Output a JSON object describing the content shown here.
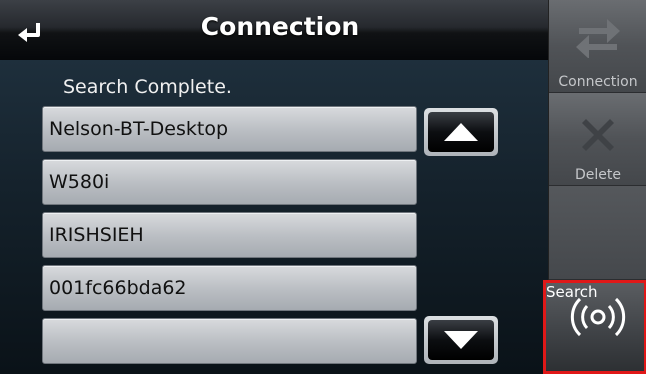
{
  "header": {
    "title": "Connection",
    "back_icon": "back-arrow-icon"
  },
  "main": {
    "status": "Search Complete.",
    "devices": [
      {
        "label": "Nelson-BT-Desktop"
      },
      {
        "label": "W580i"
      },
      {
        "label": "IRISHSIEH"
      },
      {
        "label": "001fc66bda62"
      },
      {
        "label": ""
      }
    ],
    "scroll_up_icon": "triangle-up-icon",
    "scroll_down_icon": "triangle-down-icon"
  },
  "sidebar": {
    "connection_label": "Connection",
    "delete_label": "Delete",
    "search_label": "Search",
    "highlight_color": "#e01818"
  }
}
